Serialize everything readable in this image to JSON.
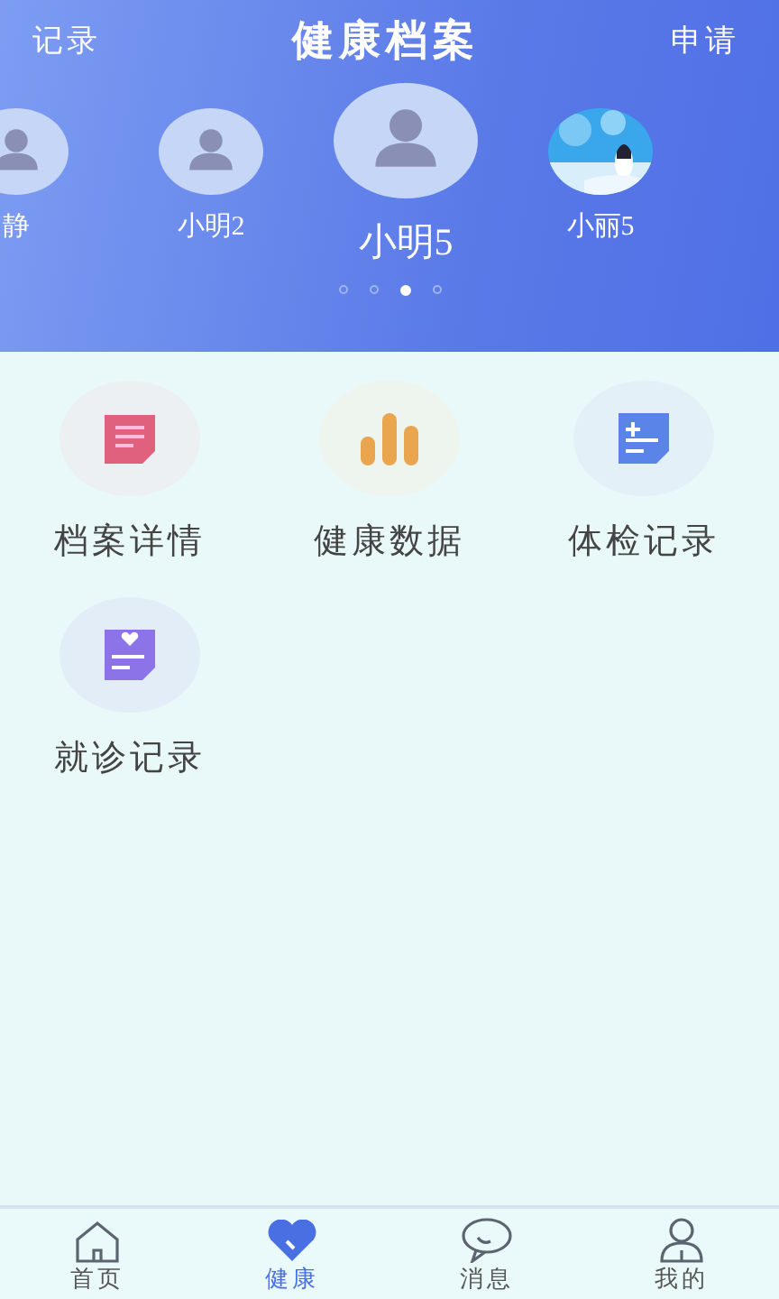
{
  "header": {
    "left": "记录",
    "title": "健康档案",
    "right": "申请"
  },
  "profiles": [
    {
      "name": "静",
      "kind": "person",
      "selected": false
    },
    {
      "name": "小明2",
      "kind": "person",
      "selected": false
    },
    {
      "name": "小明5",
      "kind": "person",
      "selected": true
    },
    {
      "name": "小丽5",
      "kind": "picture",
      "selected": false
    }
  ],
  "pager": [
    {
      "selected": false
    },
    {
      "selected": false
    },
    {
      "selected": true
    },
    {
      "selected": false
    }
  ],
  "features": [
    {
      "label": "档案详情",
      "kind": "file"
    },
    {
      "label": "健康数据",
      "kind": "bars"
    },
    {
      "label": "体检记录",
      "kind": "checkup"
    },
    {
      "label": "就诊记录",
      "kind": "visit"
    }
  ],
  "tabs": [
    {
      "label": "首页",
      "kind": "home",
      "selected": false
    },
    {
      "label": "健康",
      "kind": "heart",
      "selected": true
    },
    {
      "label": "消息",
      "kind": "chat",
      "selected": false
    },
    {
      "label": "我的",
      "kind": "user",
      "selected": false
    }
  ]
}
